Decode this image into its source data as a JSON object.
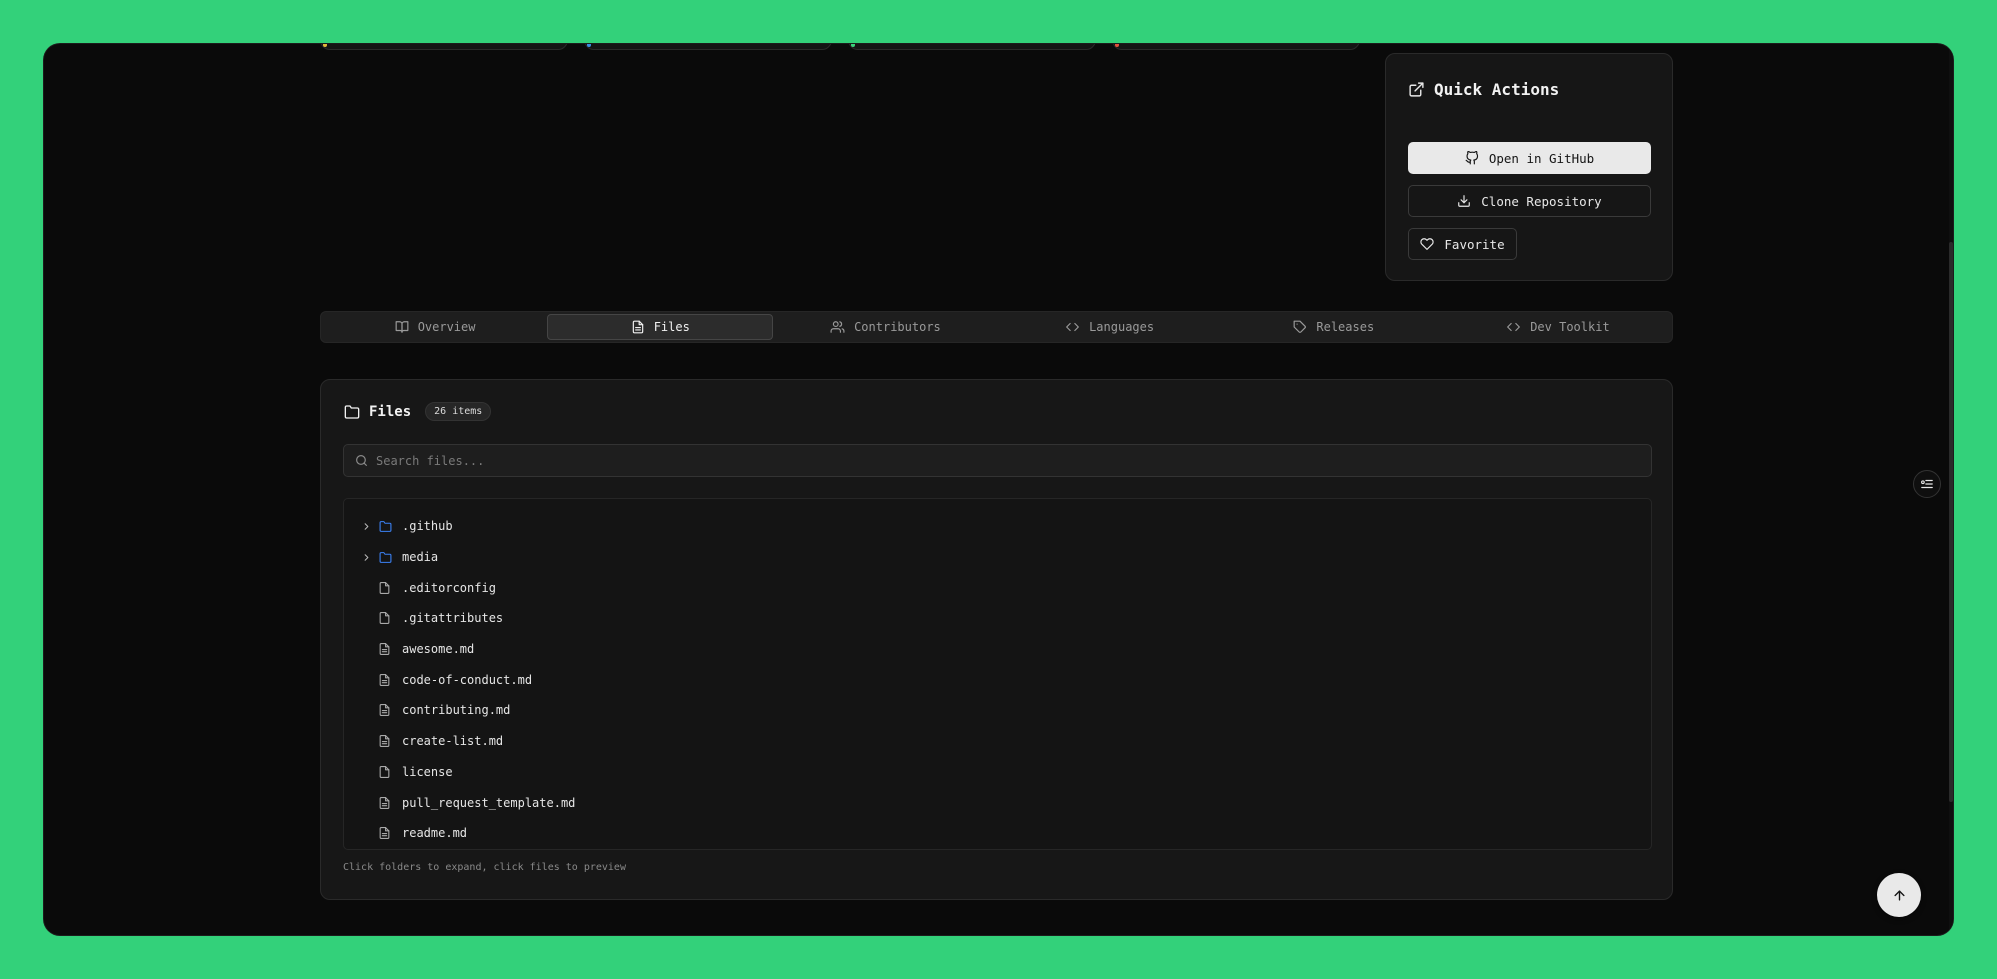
{
  "quick_actions": {
    "title": "Quick Actions",
    "open_github": "Open in GitHub",
    "clone": "Clone Repository",
    "favorite": "Favorite"
  },
  "tabs": [
    {
      "label": "Overview",
      "icon": "book-icon",
      "active": false
    },
    {
      "label": "Files",
      "icon": "file-icon",
      "active": true
    },
    {
      "label": "Contributors",
      "icon": "users-icon",
      "active": false
    },
    {
      "label": "Languages",
      "icon": "code-icon",
      "active": false
    },
    {
      "label": "Releases",
      "icon": "tag-icon",
      "active": false
    },
    {
      "label": "Dev Toolkit",
      "icon": "code-icon",
      "active": false
    }
  ],
  "files": {
    "title": "Files",
    "count": "26 items",
    "search_placeholder": "Search files...",
    "items": [
      {
        "name": ".github",
        "type": "folder"
      },
      {
        "name": "media",
        "type": "folder"
      },
      {
        "name": ".editorconfig",
        "type": "file"
      },
      {
        "name": ".gitattributes",
        "type": "file"
      },
      {
        "name": "awesome.md",
        "type": "doc"
      },
      {
        "name": "code-of-conduct.md",
        "type": "doc"
      },
      {
        "name": "contributing.md",
        "type": "doc"
      },
      {
        "name": "create-list.md",
        "type": "doc"
      },
      {
        "name": "license",
        "type": "file"
      },
      {
        "name": "pull_request_template.md",
        "type": "doc"
      },
      {
        "name": "readme.md",
        "type": "doc"
      }
    ],
    "hint": "Click folders to expand, click files to preview"
  },
  "colors": {
    "background": "#33d17a",
    "window": "#0a0a0a",
    "folder": "#3b82f6",
    "card": "#171717"
  }
}
